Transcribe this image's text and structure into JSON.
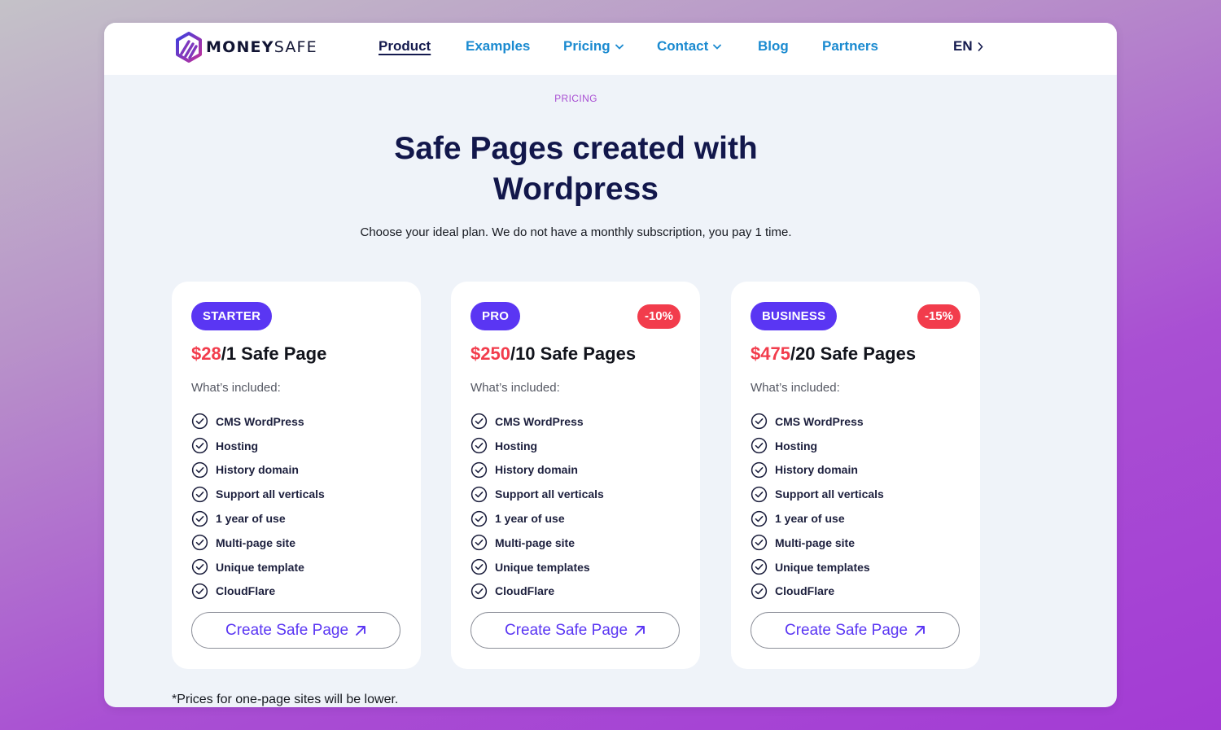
{
  "brand": {
    "name_bold": "MONEY",
    "name_light": "SAFE",
    "colors": {
      "primary": "#5a36f3",
      "accent_red": "#f23c4c",
      "nav_link": "#1a8ad0",
      "dark": "#12174b"
    }
  },
  "nav": {
    "items": [
      {
        "label": "Product",
        "active": true
      },
      {
        "label": "Examples"
      },
      {
        "label": "Pricing",
        "dropdown": true
      },
      {
        "label": "Contact",
        "dropdown": true
      },
      {
        "label": "Blog"
      },
      {
        "label": "Partners"
      }
    ],
    "language": "EN"
  },
  "hero": {
    "eyebrow": "PRICING",
    "title_line1": "Safe Pages created with",
    "title_line2": "Wordpress",
    "subtitle": "Choose your ideal plan. We do not have a monthly subscription, you pay 1 time."
  },
  "plans": [
    {
      "tier": "STARTER",
      "discount": "",
      "price": "$28",
      "unit": "/1 Safe Page",
      "included_label": "What’s included:",
      "features": [
        "CMS WordPress",
        "Hosting",
        "History domain",
        "Support all verticals",
        "1 year of use",
        "Multi-page site",
        "Unique template",
        "CloudFlare"
      ],
      "cta": "Create Safe Page"
    },
    {
      "tier": "PRO",
      "discount": "-10%",
      "price": "$250",
      "unit": "/10 Safe Pages",
      "included_label": "What’s included:",
      "features": [
        "CMS WordPress",
        "Hosting",
        "History domain",
        "Support all verticals",
        "1 year of use",
        "Multi-page site",
        "Unique templates",
        "CloudFlare"
      ],
      "cta": "Create Safe Page"
    },
    {
      "tier": "BUSINESS",
      "discount": "-15%",
      "price": "$475",
      "unit": "/20 Safe Pages",
      "included_label": "What’s included:",
      "features": [
        "CMS WordPress",
        "Hosting",
        "History domain",
        "Support all verticals",
        "1 year of use",
        "Multi-page site",
        "Unique templates",
        "CloudFlare"
      ],
      "cta": "Create Safe Page"
    }
  ],
  "footnote": "*Prices for one-page sites will be lower.",
  "icons": {
    "logo": "moneysafe-hexagon-logo",
    "feature": "check-circle-icon",
    "cta": "arrow-up-right-icon",
    "nav_dropdown": "chevron-down-icon",
    "lang": "chevron-right-icon"
  }
}
